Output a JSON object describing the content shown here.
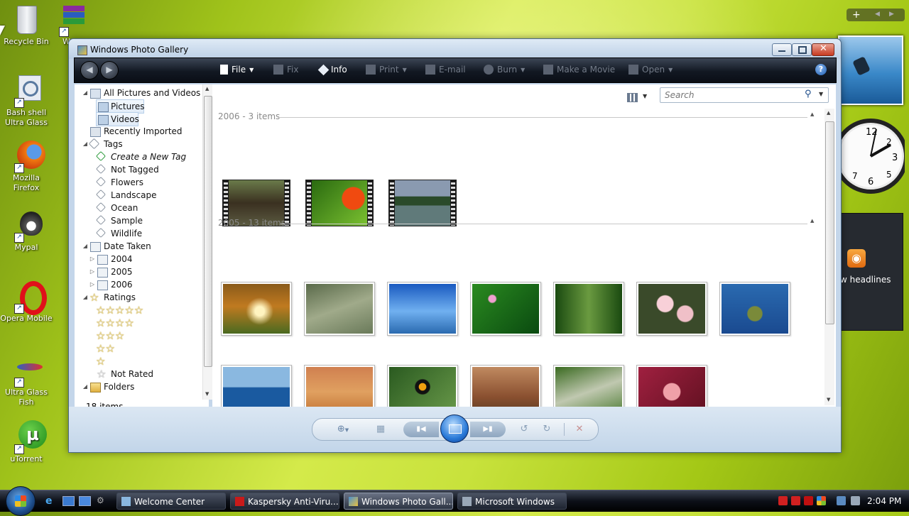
{
  "desktop": {
    "icons": [
      {
        "label": "Recycle Bin",
        "icon": "recycle-bin-icon"
      },
      {
        "label": "W",
        "icon": "winrar-icon"
      },
      {
        "label": "Bash shell Ultra Glass",
        "icon": "bash-shell-icon"
      },
      {
        "label": "Mozilla Firefox",
        "icon": "firefox-icon"
      },
      {
        "label": "Mypal",
        "icon": "mypal-icon"
      },
      {
        "label": "Opera Mobile",
        "icon": "opera-icon"
      },
      {
        "label": "Ultra Glass Fish",
        "icon": "fish-icon"
      },
      {
        "label": "uTorrent",
        "icon": "utorrent-icon"
      }
    ]
  },
  "gadgets": {
    "sidebar_add": "+",
    "feed_text": "w headlines"
  },
  "window": {
    "title": "Windows Photo Gallery",
    "toolbar": {
      "file": "File",
      "fix": "Fix",
      "info": "Info",
      "print": "Print",
      "email": "E-mail",
      "burn": "Burn",
      "make_movie": "Make a Movie",
      "open": "Open"
    },
    "nav": {
      "all": "All Pictures and Videos",
      "pictures": "Pictures",
      "videos": "Videos",
      "recent": "Recently Imported",
      "tags": "Tags",
      "create_tag": "Create a New Tag",
      "not_tagged": "Not Tagged",
      "flowers": "Flowers",
      "landscape": "Landscape",
      "ocean": "Ocean",
      "sample": "Sample",
      "wildlife": "Wildlife",
      "date_taken": "Date Taken",
      "y2004": "2004",
      "y2005": "2005",
      "y2006": "2006",
      "ratings": "Ratings",
      "not_rated": "Not Rated",
      "folders": "Folders"
    },
    "status": "18 items",
    "search_placeholder": "Search",
    "groups": [
      {
        "label": "2006 - 3 items"
      },
      {
        "label": "2005 - 13 items"
      }
    ],
    "colors": {
      "accent": "#1c4c8a",
      "toolbar": "#121822"
    }
  },
  "taskbar": {
    "items": [
      "Welcome Center",
      "Kaspersky Anti-Viru...",
      "Windows Photo Gall...",
      "Microsoft Windows"
    ],
    "clock": "2:04 PM"
  }
}
